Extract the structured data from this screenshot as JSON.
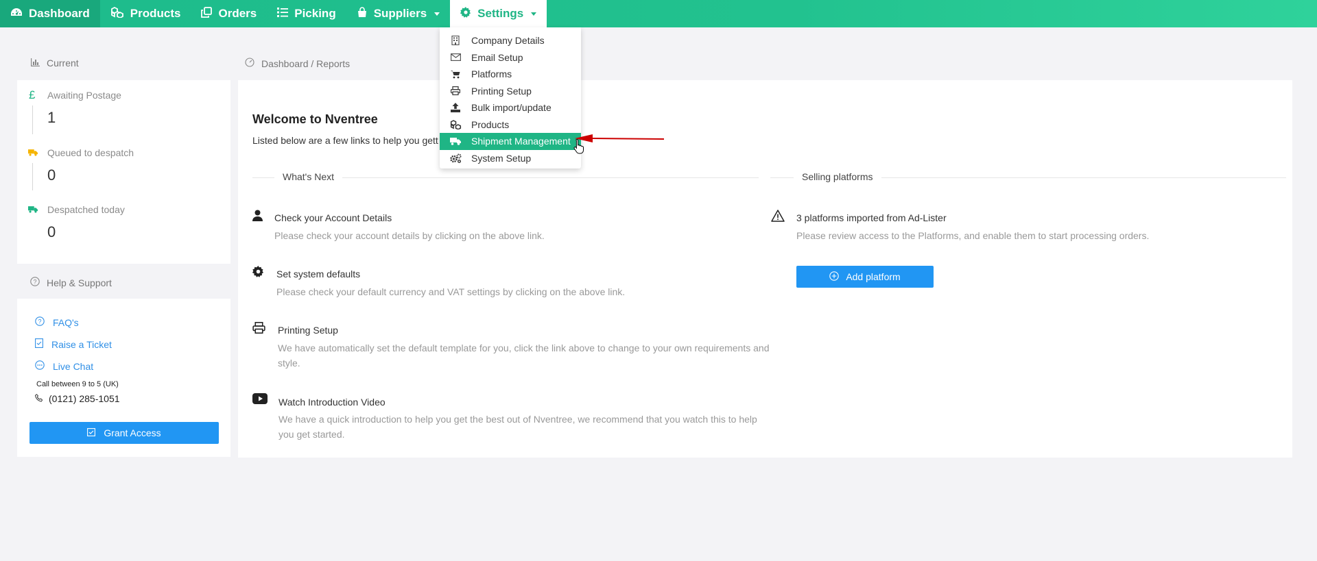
{
  "nav": {
    "items": [
      {
        "label": "Dashboard",
        "icon": "dashboard-icon"
      },
      {
        "label": "Products",
        "icon": "cubes-icon"
      },
      {
        "label": "Orders",
        "icon": "copy-icon"
      },
      {
        "label": "Picking",
        "icon": "list-icon"
      },
      {
        "label": "Suppliers",
        "icon": "bag-icon",
        "dropdown": true
      },
      {
        "label": "Settings",
        "icon": "gear-icon",
        "dropdown": true,
        "open": true
      }
    ]
  },
  "settings_menu": {
    "items": [
      {
        "label": "Company Details",
        "icon": "building-icon"
      },
      {
        "label": "Email Setup",
        "icon": "envelope-icon"
      },
      {
        "label": "Platforms",
        "icon": "cart-icon"
      },
      {
        "label": "Printing Setup",
        "icon": "printer-icon"
      },
      {
        "label": "Bulk import/update",
        "icon": "upload-icon"
      },
      {
        "label": "Products",
        "icon": "cubes-icon"
      },
      {
        "label": "Shipment Management",
        "icon": "truck-icon",
        "highlighted": true
      },
      {
        "label": "System Setup",
        "icon": "cogs-icon"
      }
    ]
  },
  "left": {
    "current_label": "Current",
    "stats": [
      {
        "label": "Awaiting Postage",
        "value": "1",
        "icon": "pound-icon"
      },
      {
        "label": "Queued to despatch",
        "value": "0",
        "icon": "truck-icon"
      },
      {
        "label": "Despatched today",
        "value": "0",
        "icon": "truck-icon"
      }
    ],
    "help_label": "Help & Support",
    "links": [
      "FAQ's",
      "Raise a Ticket",
      "Live Chat"
    ],
    "call_hours": "Call between 9 to 5 (UK)",
    "phone": "(0121) 285-1051",
    "grant_access": "Grant Access"
  },
  "breadcrumb": "Dashboard / Reports",
  "main": {
    "title": "Welcome to Nventree",
    "subtitle": "Listed below are a few links to help you gett",
    "whats_next": "What's Next",
    "selling_platforms": "Selling platforms",
    "tasks": [
      {
        "title": "Check your Account Details",
        "desc": "Please check your account details by clicking on the above link."
      },
      {
        "title": "Set system defaults",
        "desc": "Please check your default currency and VAT settings by clicking on the above link."
      },
      {
        "title": "Printing Setup",
        "desc": "We have automatically set the default template for you, click the link above to change to your own requirements and style."
      },
      {
        "title": "Watch Introduction Video",
        "desc": "We have a quick introduction to help you get the best out of Nventree, we recommend that you watch this to help you get started."
      }
    ],
    "platform_notice": "3 platforms imported from Ad-Lister",
    "platform_desc": "Please review access to the Platforms, and enable them to start processing orders.",
    "add_platform": "Add platform"
  },
  "colors": {
    "brand_green": "#1fb585",
    "primary_blue": "#2196f3",
    "annotation_red": "#cc0000"
  }
}
